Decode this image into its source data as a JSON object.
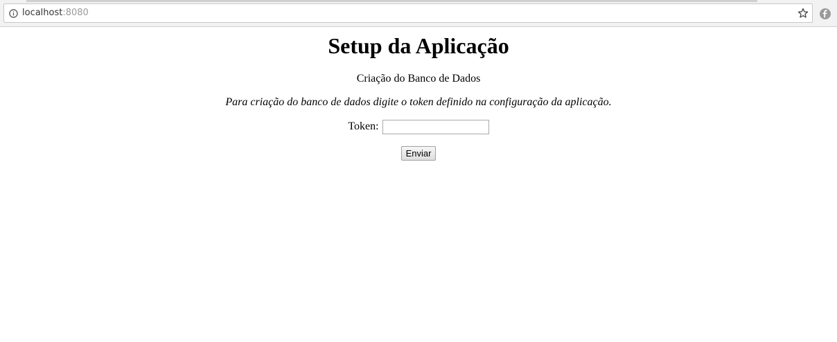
{
  "browser": {
    "url_host": "localhost",
    "url_port": ":8080"
  },
  "page": {
    "title": "Setup da Aplicação",
    "subtitle": "Criação do Banco de Dados",
    "instruction": "Para criação do banco de dados digite o token definido na configuração da aplicação.",
    "form": {
      "token_label": "Token:",
      "token_value": "",
      "submit_label": "Enviar"
    }
  }
}
